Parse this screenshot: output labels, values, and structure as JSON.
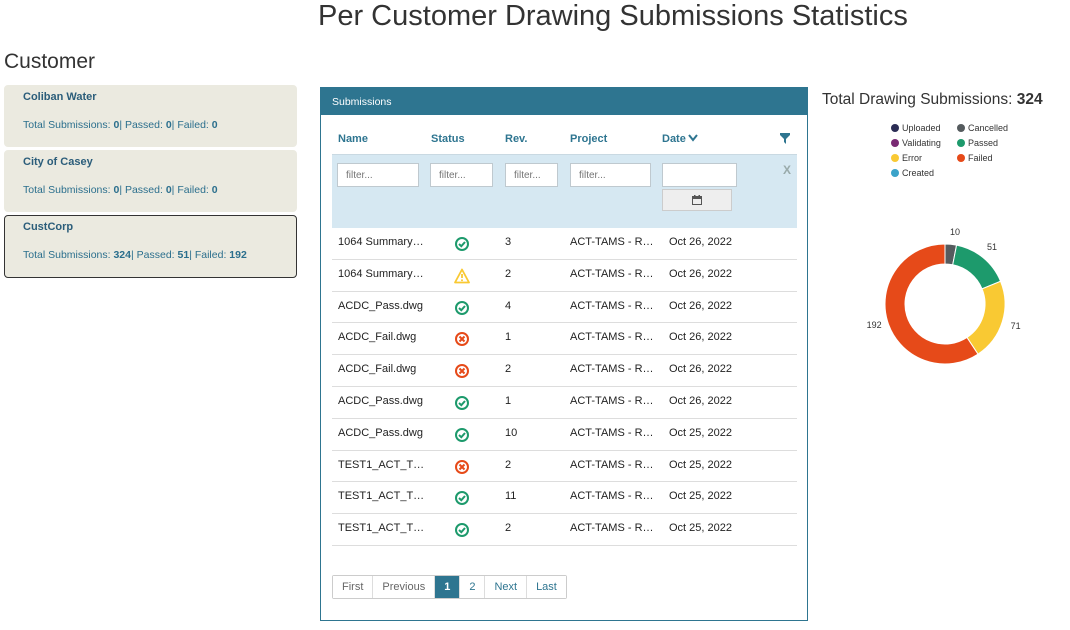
{
  "page_title": "Per Customer Drawing Submissions Statistics",
  "customer_heading": "Customer",
  "customers": [
    {
      "name": "Coliban Water",
      "total_label": "Total Submissions: ",
      "total": "0",
      "passed_label": "| Passed: ",
      "passed": "0",
      "failed_label": "| Failed: ",
      "failed": "0"
    },
    {
      "name": "City of Casey",
      "total_label": "Total Submissions: ",
      "total": "0",
      "passed_label": "| Passed: ",
      "passed": "0",
      "failed_label": "| Failed: ",
      "failed": "0"
    },
    {
      "name": "CustCorp",
      "total_label": "Total Submissions: ",
      "total": "324",
      "passed_label": "| Passed: ",
      "passed": "51",
      "failed_label": "| Failed: ",
      "failed": "192"
    }
  ],
  "submissions": {
    "title": "Submissions",
    "columns": [
      "Name",
      "Status",
      "Rev.",
      "Project",
      "Date"
    ],
    "filter_placeholder": "filter...",
    "clear_label": "X",
    "rows": [
      {
        "name": "1064 Summary…",
        "status": "passed",
        "rev": "3",
        "project": "ACT-TAMS - R…",
        "date": "Oct 26, 2022"
      },
      {
        "name": "1064 Summary…",
        "status": "error",
        "rev": "2",
        "project": "ACT-TAMS - R…",
        "date": "Oct 26, 2022"
      },
      {
        "name": "ACDC_Pass.dwg",
        "status": "passed",
        "rev": "4",
        "project": "ACT-TAMS - R…",
        "date": "Oct 26, 2022"
      },
      {
        "name": "ACDC_Fail.dwg",
        "status": "failed",
        "rev": "1",
        "project": "ACT-TAMS - R…",
        "date": "Oct 26, 2022"
      },
      {
        "name": "ACDC_Fail.dwg",
        "status": "failed",
        "rev": "2",
        "project": "ACT-TAMS - R…",
        "date": "Oct 26, 2022"
      },
      {
        "name": "ACDC_Pass.dwg",
        "status": "passed",
        "rev": "1",
        "project": "ACT-TAMS - R…",
        "date": "Oct 26, 2022"
      },
      {
        "name": "ACDC_Pass.dwg",
        "status": "passed",
        "rev": "10",
        "project": "ACT-TAMS - R…",
        "date": "Oct 25, 2022"
      },
      {
        "name": "TEST1_ACT_T…",
        "status": "failed",
        "rev": "2",
        "project": "ACT-TAMS - R…",
        "date": "Oct 25, 2022"
      },
      {
        "name": "TEST1_ACT_T…",
        "status": "passed",
        "rev": "11",
        "project": "ACT-TAMS - R…",
        "date": "Oct 25, 2022"
      },
      {
        "name": "TEST1_ACT_T…",
        "status": "passed",
        "rev": "2",
        "project": "ACT-TAMS - R…",
        "date": "Oct 25, 2022"
      }
    ],
    "pager": {
      "first": "First",
      "previous": "Previous",
      "pages": [
        "1",
        "2"
      ],
      "current_page": "1",
      "next": "Next",
      "last": "Last"
    }
  },
  "summary": {
    "total_label": "Total Drawing Submissions: ",
    "total": "324"
  },
  "colors": {
    "accent": "#2e7590",
    "passed": "#1d9a6c",
    "failed": "#e64a19",
    "error": "#f9c933",
    "cancelled": "#555b5e",
    "uploaded": "#2b2d55",
    "validating": "#7a2a74",
    "created": "#3ba3c9"
  },
  "chart_data": {
    "type": "pie",
    "variant": "donut",
    "legend": [
      {
        "label": "Uploaded",
        "color": "#2b2d55"
      },
      {
        "label": "Cancelled",
        "color": "#555b5e"
      },
      {
        "label": "Validating",
        "color": "#7a2a74"
      },
      {
        "label": "Passed",
        "color": "#1d9a6c"
      },
      {
        "label": "Error",
        "color": "#f9c933"
      },
      {
        "label": "Failed",
        "color": "#e64a19"
      },
      {
        "label": "Created",
        "color": "#3ba3c9"
      }
    ],
    "slices": [
      {
        "label": "Cancelled",
        "value": 10,
        "color": "#555b5e"
      },
      {
        "label": "Passed",
        "value": 51,
        "color": "#1d9a6c"
      },
      {
        "label": "Error",
        "value": 71,
        "color": "#f9c933"
      },
      {
        "label": "Failed",
        "value": 192,
        "color": "#e64a19"
      }
    ],
    "legend_position": "top"
  }
}
